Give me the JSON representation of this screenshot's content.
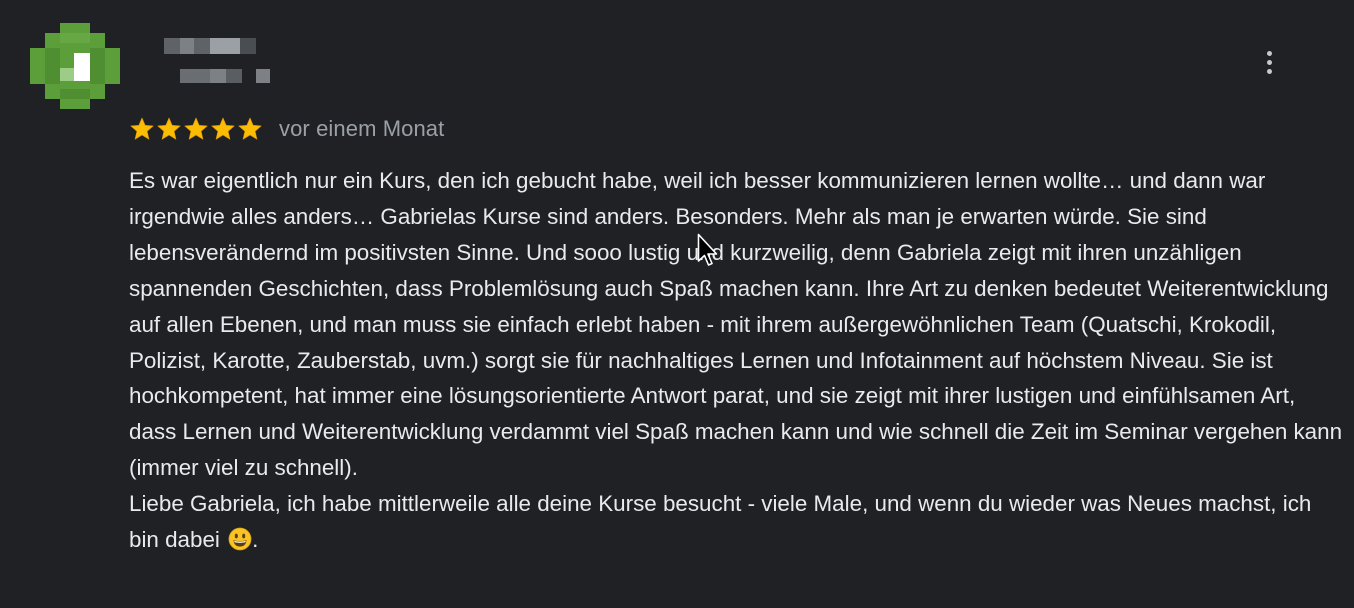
{
  "review": {
    "rating": 5,
    "rating_max": 5,
    "date": "vor einem Monat",
    "paragraphs": [
      "Es war eigentlich nur ein Kurs, den ich gebucht habe, weil ich besser kommunizieren lernen wollte… und dann war irgendwie alles anders… Gabrielas Kurse sind anders. Besonders. Mehr als man je erwarten würde. Sie sind lebensverändernd im positivsten Sinne. Und sooo lustig und kurzweilig, denn Gabriela zeigt mit ihren unzähligen spannenden Geschichten, dass Problemlösung auch Spaß machen kann. Ihre Art zu denken bedeutet Weiterentwicklung auf allen Ebenen, und man muss sie einfach erlebt haben - mit ihrem außergewöhnlichen Team (Quatschi, Krokodil, Polizist, Karotte, Zauberstab, uvm.) sorgt sie für nachhaltiges Lernen und Infotainment auf höchstem Niveau. Sie ist hochkompetent, hat immer eine lösungsorientierte Antwort parat, und sie zeigt mit ihrer lustigen und einfühlsamen Art, dass Lernen und Weiterentwicklung verdammt viel Spaß machen kann und wie schnell die Zeit im Seminar vergehen kann (immer viel zu schnell).",
      "Liebe Gabriela, ich habe mittlerweile alle deine Kurse besucht - viele Male, und wenn du wieder was Neues machst, ich bin dabei"
    ],
    "trailing_punctuation": "."
  },
  "icons": {
    "star": "star-icon",
    "more": "more-vert-icon",
    "emoji": "grinning-face-emoji",
    "cursor": "mouse-cursor"
  },
  "colors": {
    "background": "#202124",
    "text": "#e8eaed",
    "secondary_text": "#9aa0a6",
    "star": "#fbbc04",
    "avatar_green": "#5b9e3a"
  }
}
